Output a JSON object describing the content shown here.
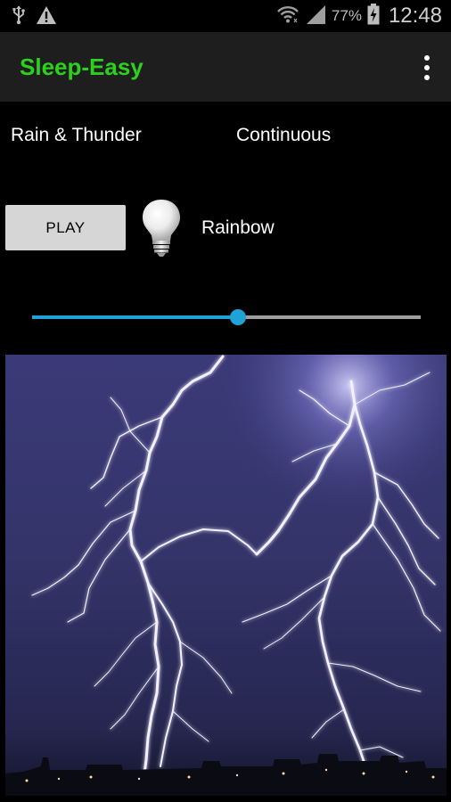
{
  "status_bar": {
    "battery_percent": "77%",
    "time": "12:48"
  },
  "icons": {
    "usb": "usb-icon",
    "warning": "warning-icon",
    "wifi": "wifi-icon",
    "signal": "signal-icon",
    "battery": "battery-charging-icon",
    "menu": "overflow-menu-icon",
    "bulb": "light-bulb-icon"
  },
  "app_bar": {
    "title": "Sleep-Easy"
  },
  "sound": {
    "name": "Rain & Thunder",
    "mode": "Continuous"
  },
  "controls": {
    "play_label": "PLAY",
    "light_color": "Rainbow"
  },
  "volume": {
    "level_fraction": 0.53
  },
  "colors": {
    "title_green": "#2cd11d",
    "accent_blue": "#1fa2d6",
    "app_bar_bg": "#1e1e1e",
    "button_bg": "#d6d6d6"
  },
  "image": {
    "subject": "lightning-storm-photo"
  }
}
